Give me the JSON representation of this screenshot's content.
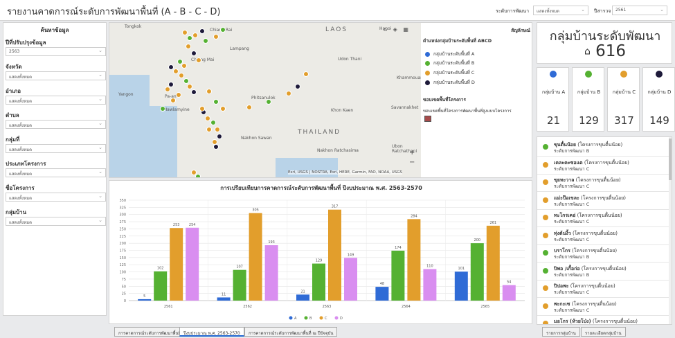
{
  "header": {
    "title": "รายงานคาดการณ์ระดับการพัฒนาพื้นที่ (A - B - C - D)",
    "level_label": "ระดับการพัฒนา",
    "level_value": "แสดงทั้งหมด",
    "year_label": "ปีสารวจ",
    "year_value": "2561"
  },
  "filter": {
    "title": "ค้นหาข้อมูล",
    "fields": [
      {
        "label": "ปีที่ปรับปรุงข้อมูล",
        "value": "2563"
      },
      {
        "label": "จังหวัด",
        "value": "แสดงทั้งหมด"
      },
      {
        "label": "อำเภอ",
        "value": "แสดงทั้งหมด"
      },
      {
        "label": "ตำบล",
        "value": "แสดงทั้งหมด"
      },
      {
        "label": "กลุ่มที่",
        "value": "แสดงทั้งหมด"
      },
      {
        "label": "ประเภทโครงการ",
        "value": "แสดงทั้งหมด"
      },
      {
        "label": "ชื่อโครงการ",
        "value": "แสดงทั้งหมด"
      },
      {
        "label": "กลุ่มบ้าน",
        "value": "แสดงทั้งหมด"
      }
    ]
  },
  "map": {
    "labels": [
      "Tongkok",
      "Chiang Rai",
      "Chiang Mai",
      "Lampang",
      "LAOS",
      "Udon Thani",
      "Khammouan",
      "Yangon",
      "Pa-an",
      "Mawlamyine",
      "Phitsanulok",
      "Khon Kaen",
      "Savannakhet",
      "THAILAND",
      "Nakhon Sawan",
      "Ubon Ratchathani",
      "Nakhon Ratchasima",
      "Hanoi"
    ],
    "attribution": "Esri, USGS | NOSTRA, Esri, HERE, Garmin, FAO, NOAA, USGS",
    "legend": {
      "title": "สัญลักษณ์",
      "group_title": "ตำแหน่งกลุ่มบ้านระดับพื้นที่ ABCD",
      "items": [
        "กลุ่มบ้านระดับพื้นที่ A",
        "กลุ่มบ้านระดับพื้นที่ B",
        "กลุ่มบ้านระดับพื้นที่ C",
        "กลุ่มบ้านระดับพื้นที่ D"
      ],
      "boundary_title": "ขอบเขตพื้นที่โครงการ",
      "boundary_item": "ขอบเขตพื้นที่โครงการพัฒนาพื้นที่สูงแบบโครงการ"
    },
    "zoom_in": "+",
    "zoom_out": "−"
  },
  "chart_data": {
    "type": "bar",
    "title": "การเปรียบเทียบการคาดการณ์ระดับการพัฒนาพื้นที่ ปีงบประมาณ พ.ศ. 2563-2570",
    "categories": [
      "2561",
      "2562",
      "2563",
      "2564",
      "2565"
    ],
    "series": [
      {
        "name": "A",
        "color": "#2f6bd6",
        "values": [
          5,
          11,
          21,
          48,
          101
        ]
      },
      {
        "name": "B",
        "color": "#55b132",
        "values": [
          102,
          107,
          129,
          174,
          200
        ]
      },
      {
        "name": "C",
        "color": "#e29e2c",
        "values": [
          253,
          305,
          317,
          284,
          261
        ]
      },
      {
        "name": "D",
        "color": "#d98ef0",
        "values": [
          254,
          193,
          149,
          110,
          54
        ]
      }
    ],
    "ylim": [
      0,
      350
    ],
    "yticks": [
      "0",
      "25",
      "50",
      "75",
      "100",
      "125",
      "150",
      "175",
      "200",
      "225",
      "250",
      "275",
      "300",
      "325",
      "350"
    ],
    "legend_position": "bottom"
  },
  "tabs": {
    "left": [
      "การคาดการณ์ระดับการพัฒนาพื้นที่",
      "ปีงบประมาณ พ.ศ. 2563-2570",
      "การคาดการณ์ระดับการพัฒนาพื้นที่ ณ ปีปัจจุบัน"
    ],
    "right": [
      "รายการกลุ่มบ้าน",
      "รายละเอียดกลุ่มบ้าน"
    ]
  },
  "summary": {
    "title": "กลุ่มบ้านระดับพัฒนา",
    "total": "616",
    "cards": [
      {
        "label": "กลุ่มบ้าน A",
        "value": "21",
        "color": "#2f6bd6"
      },
      {
        "label": "กลุ่มบ้าน B",
        "value": "129",
        "color": "#55b132"
      },
      {
        "label": "กลุ่มบ้าน C",
        "value": "317",
        "color": "#e29e2c"
      },
      {
        "label": "กลุ่มบ้าน D",
        "value": "149",
        "color": "#1e1a3a"
      }
    ]
  },
  "villages": [
    {
      "name": "ขุนตื๋นน้อย",
      "project": "(โครงการขุนตื๋นน้อย)",
      "level": "ระดับการพัฒนา B",
      "color": "#55b132"
    },
    {
      "name": "เคละคะซอแต",
      "project": "(โครงการขุนตื๋นน้อย)",
      "level": "ระดับการพัฒนา C",
      "color": "#e29e2c"
    },
    {
      "name": "ขุยทะวาล",
      "project": "(โครงการขุนตื๋นน้อย)",
      "level": "ระดับการพัฒนา C",
      "color": "#e29e2c"
    },
    {
      "name": "แม่ะป๊อเขละ",
      "project": "(โครงการขุนตื๋นน้อย)",
      "level": "ระดับการพัฒนา C",
      "color": "#e29e2c"
    },
    {
      "name": "ทะโกรเคอ่",
      "project": "(โครงการขุนตื๋นน้อย)",
      "level": "ระดับการพัฒนา C",
      "color": "#e29e2c"
    },
    {
      "name": "ทุ่งต้นงิ้ว",
      "project": "(โครงการขุนตื๋นน้อย)",
      "level": "ระดับการพัฒนา C",
      "color": "#e29e2c"
    },
    {
      "name": "บราโกร",
      "project": "(โครงการขุนตื๋นน้อย)",
      "level": "ระดับการพัฒนา B",
      "color": "#55b132"
    },
    {
      "name": "ปิพอ /เกื้อก่อ",
      "project": "(โครงการขุนตื๋นน้อย)",
      "level": "ระดับการพัฒนา B",
      "color": "#55b132"
    },
    {
      "name": "ปิปอพะ",
      "project": "(โครงการขุนตื๋นน้อย)",
      "level": "ระดับการพัฒนา C",
      "color": "#e29e2c"
    },
    {
      "name": "พะกะเซ",
      "project": "(โครงการขุนตื๋นน้อย)",
      "level": "ระดับการพัฒนา C",
      "color": "#e29e2c"
    },
    {
      "name": "มอโกร (ห้วยโป่ง)",
      "project": "(โครงการขุนตื๋นน้อย)",
      "level": "ระดับการพัฒนา C",
      "color": "#e29e2c"
    }
  ]
}
